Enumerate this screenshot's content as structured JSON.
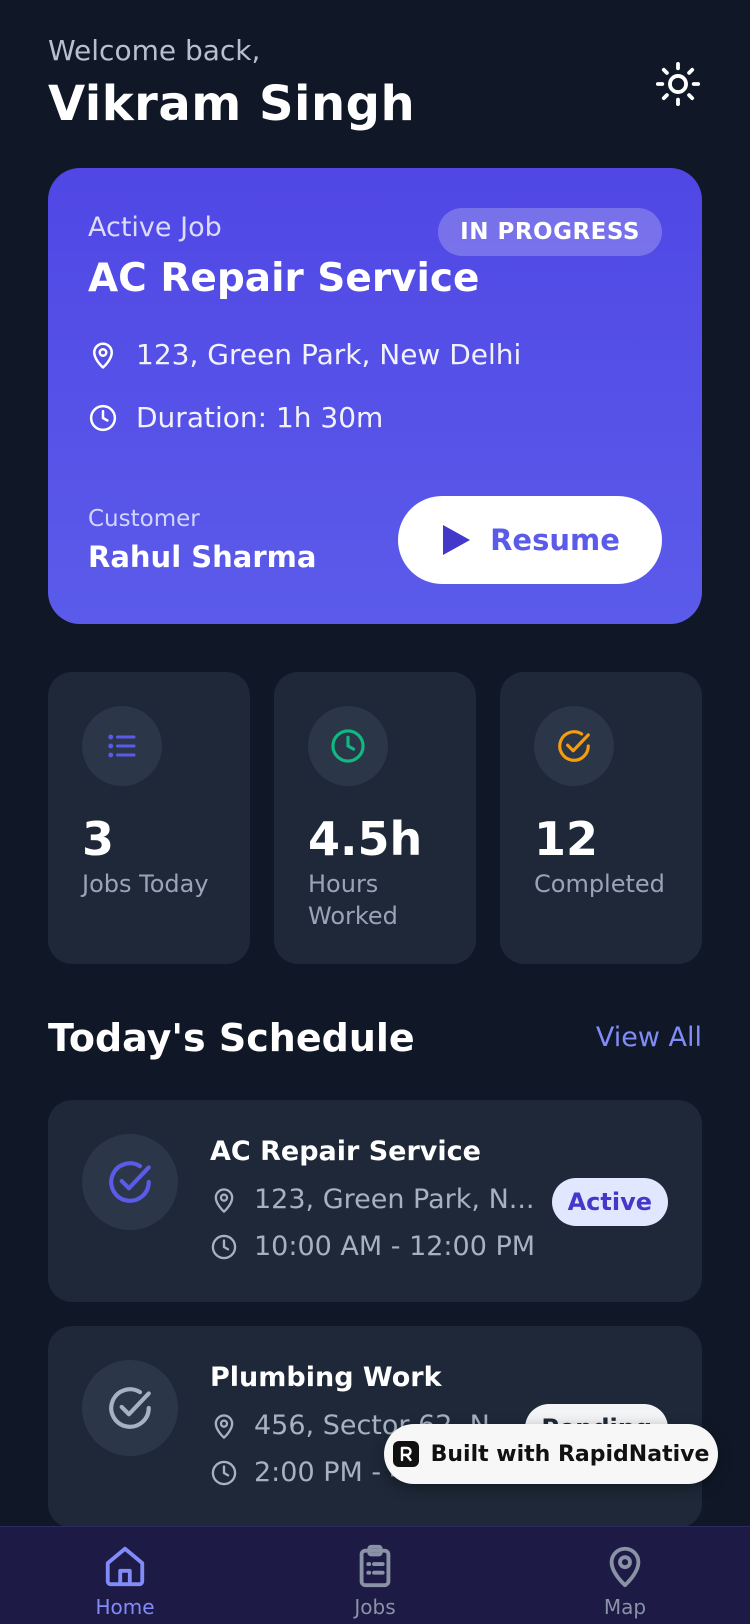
{
  "header": {
    "welcome": "Welcome back,",
    "user_name": "Vikram Singh",
    "theme_icon": "sun-icon"
  },
  "active_job": {
    "label": "Active Job",
    "status": "IN PROGRESS",
    "title": "AC Repair Service",
    "address": "123, Green Park, New Delhi",
    "duration": "Duration: 1h 30m",
    "customer_label": "Customer",
    "customer_name": "Rahul Sharma",
    "resume_label": "Resume"
  },
  "stats": [
    {
      "value": "3",
      "label": "Jobs Today",
      "icon": "list-icon",
      "color": "#5b5bea"
    },
    {
      "value": "4.5h",
      "label": "Hours Worked",
      "icon": "clock-icon",
      "color": "#10b981"
    },
    {
      "value": "12",
      "label": "Completed",
      "icon": "check-circle-icon",
      "color": "#f59e0b"
    }
  ],
  "schedule": {
    "title": "Today's Schedule",
    "view_all": "View All",
    "items": [
      {
        "title": "AC Repair Service",
        "address": "123, Green Park, N...",
        "time": "10:00 AM - 12:00 PM",
        "badge": "Active",
        "icon_color": "#5b5bea"
      },
      {
        "title": "Plumbing Work",
        "address": "456, Sector 62, N...",
        "time": "2:00 PM - 4:00 PM",
        "badge": "Pending",
        "icon_color": "#a8b1c1"
      }
    ]
  },
  "built_with": "Built with RapidNative",
  "nav": {
    "items": [
      {
        "label": "Home",
        "icon": "home-icon"
      },
      {
        "label": "Jobs",
        "icon": "clipboard-icon"
      },
      {
        "label": "Map",
        "icon": "map-pin-icon"
      }
    ]
  },
  "colors": {
    "background": "#101828",
    "card": "#1e2838",
    "accent": "#5b5bea",
    "link": "#818cf8",
    "nav_background": "#1d1b45"
  }
}
